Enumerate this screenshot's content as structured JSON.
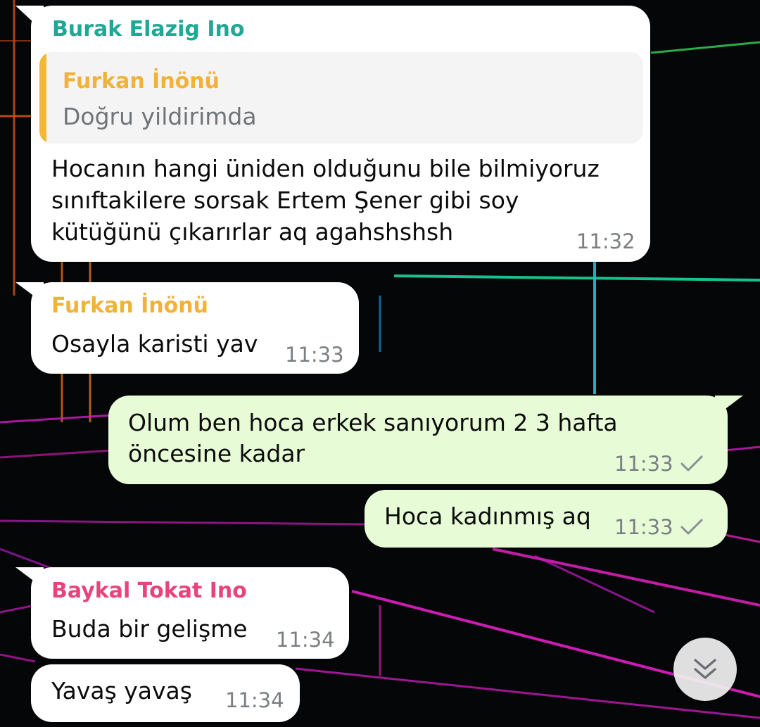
{
  "chat": {
    "messages": [
      {
        "direction": "in",
        "sender": "Burak Elazig Ino",
        "sender_color": "#1ea895",
        "reply_to": {
          "sender": "Furkan İnönü",
          "text": "Doğru yildirimda"
        },
        "lines": [
          "Hocanın hangi üniden olduğunu bile bilmiyoruz",
          "sınıftakilere sorsak Ertem Şener gibi soy",
          "kütüğünü çıkarırlar aq agahshshsh"
        ],
        "time": "11:32"
      },
      {
        "direction": "in",
        "sender": "Furkan İnönü",
        "sender_color": "#f0b23a",
        "lines": [
          "Osayla karisti yav"
        ],
        "time": "11:33"
      },
      {
        "direction": "out",
        "lines": [
          "Olum ben hoca erkek sanıyorum 2 3 hafta",
          "öncesine kadar"
        ],
        "time": "11:33",
        "status_icon": "single-check-icon"
      },
      {
        "direction": "out",
        "lines": [
          "Hoca kadınmış aq"
        ],
        "time": "11:33",
        "status_icon": "single-check-icon"
      },
      {
        "direction": "in",
        "sender": "Baykal Tokat Ino",
        "sender_color": "#e8437a",
        "lines": [
          "Buda bir gelişme"
        ],
        "time": "11:34"
      },
      {
        "direction": "in",
        "lines": [
          "Yavaş yavaş"
        ],
        "time": "11:34"
      }
    ]
  },
  "scroll_button": {
    "icon": "double-chevron-down-icon"
  },
  "colors": {
    "incoming_bubble": "#ffffff",
    "outgoing_bubble": "#e7fcd6",
    "timestamp": "#7a7f83",
    "quote_bar": "#f3b738",
    "wallpaper": "#050608"
  }
}
